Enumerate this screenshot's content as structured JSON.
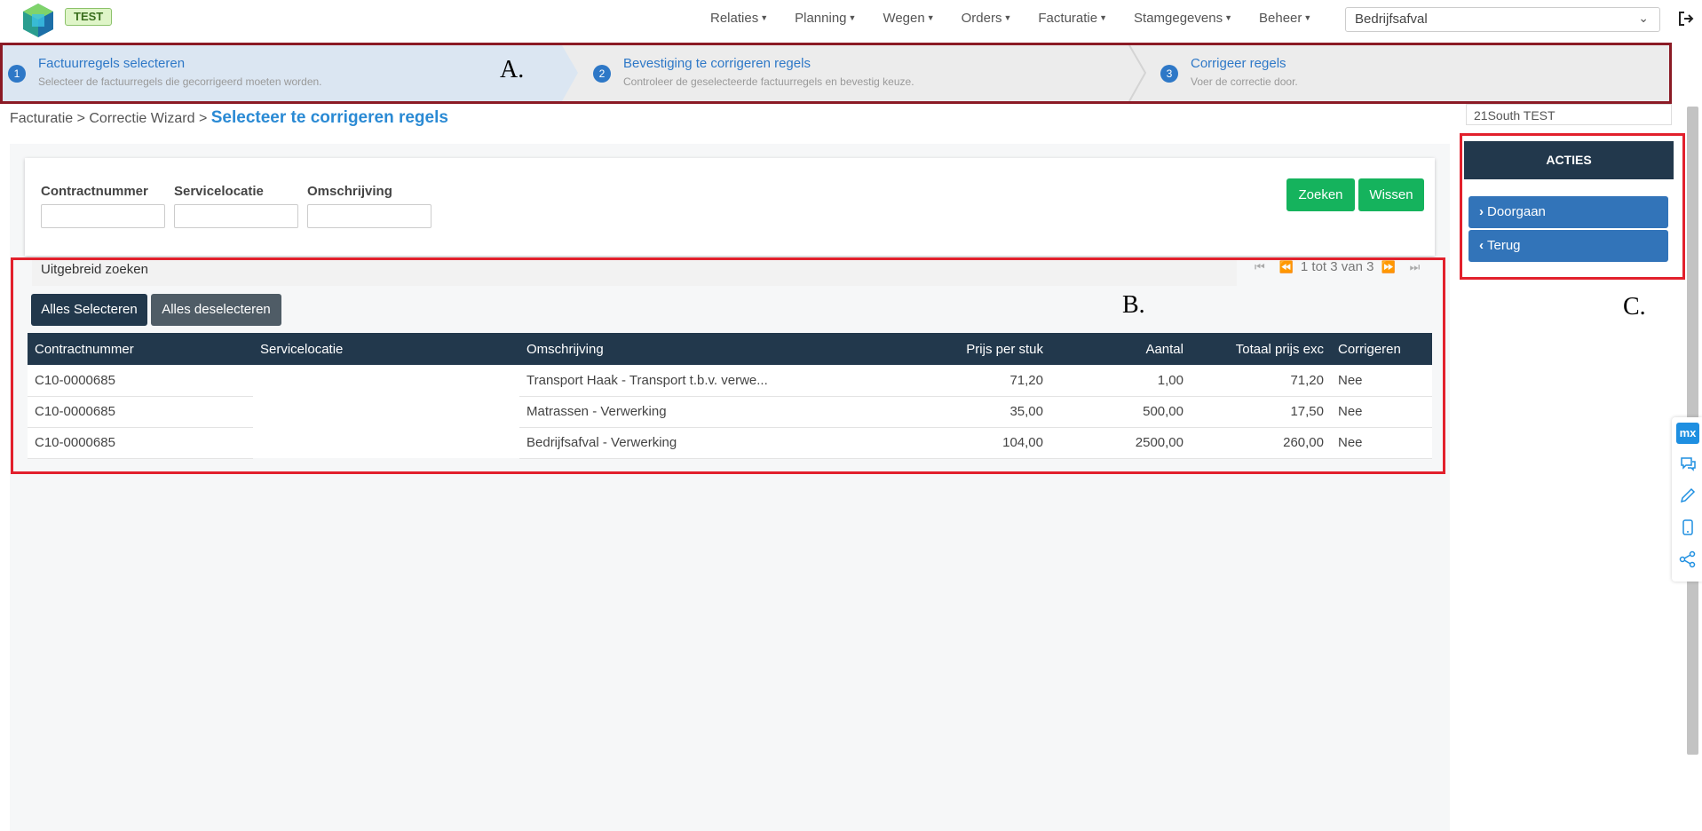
{
  "header": {
    "badge": "TEST",
    "nav": [
      "Relaties",
      "Planning",
      "Wegen",
      "Orders",
      "Facturatie",
      "Stamgegevens",
      "Beheer"
    ],
    "org_select": "Bedrijfsafval"
  },
  "wizard": {
    "steps": [
      {
        "num": "1",
        "title": "Factuurregels selecteren",
        "subtitle": "Selecteer de factuurregels die gecorrigeerd moeten worden."
      },
      {
        "num": "2",
        "title": "Bevestiging te corrigeren regels",
        "subtitle": "Controleer de geselecteerde factuurregels en bevestig keuze."
      },
      {
        "num": "3",
        "title": "Corrigeer regels",
        "subtitle": "Voer de correctie door."
      }
    ],
    "marker": "A."
  },
  "breadcrumb": {
    "path": "Facturatie > Correctie Wizard > ",
    "current": "Selecteer te corrigeren regels"
  },
  "search": {
    "fields": [
      "Contractnummer",
      "Servicelocatie",
      "Omschrijving"
    ],
    "search_button": "Zoeken",
    "clear_button": "Wissen",
    "advanced": "Uitgebreid zoeken"
  },
  "grid": {
    "marker": "B.",
    "pager_text": "1 tot 3 van 3",
    "select_all": "Alles Selecteren",
    "deselect_all": "Alles deselecteren",
    "columns": [
      "Contractnummer",
      "Servicelocatie",
      "Omschrijving",
      "Prijs per stuk",
      "Aantal",
      "Totaal prijs exc",
      "Corrigeren"
    ],
    "rows": [
      [
        "C10-0000685",
        "",
        "Transport Haak - Transport t.b.v. verwe...",
        "71,20",
        "1,00",
        "71,20",
        "Nee"
      ],
      [
        "C10-0000685",
        "",
        "Matrassen - Verwerking",
        "35,00",
        "500,00",
        "17,50",
        "Nee"
      ],
      [
        "C10-0000685",
        "",
        "Bedrijfsafval - Verwerking",
        "104,00",
        "2500,00",
        "260,00",
        "Nee"
      ]
    ]
  },
  "sidebar": {
    "org_label": "21South TEST",
    "actions_title": "ACTIES",
    "continue_button": "Doorgaan",
    "back_button": "Terug",
    "marker": "C."
  },
  "tools": {
    "mx_label": "mx"
  },
  "colors": {
    "accent": "#2e78c7",
    "dark": "#22384c",
    "green": "#15b35d",
    "region_red": "#e2202c",
    "region_dark_red": "#8b1a25"
  }
}
